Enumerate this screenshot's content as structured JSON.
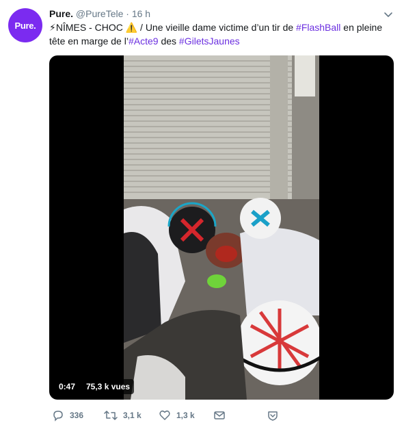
{
  "account": {
    "avatar_text": "Pure.",
    "name": "Pure.",
    "handle": "@PureTele",
    "separator": "·",
    "time": "16 h"
  },
  "tweet": {
    "lead": "⚡NÎMES - CHOC ⚠️ / Une vieille dame victime d’un tir de ",
    "tag_flashball": "#FlashBall",
    "mid1": " en pleine tête en marge de l’",
    "tag_acte9": "#Acte9",
    "mid2": " des ",
    "tag_giletsjaunes": "#GiletsJaunes"
  },
  "video": {
    "duration": "0:47",
    "views": "75,3 k vues"
  },
  "actions": {
    "reply_count": "336",
    "retweet_count": "3,1 k",
    "like_count": "1,3 k"
  },
  "colors": {
    "brand": "#7b2bf0",
    "link": "#1da1f2",
    "muted": "#657786"
  },
  "icons": [
    "caret-down-icon",
    "reply-icon",
    "retweet-icon",
    "like-icon",
    "direct-message-icon",
    "share-icon"
  ]
}
